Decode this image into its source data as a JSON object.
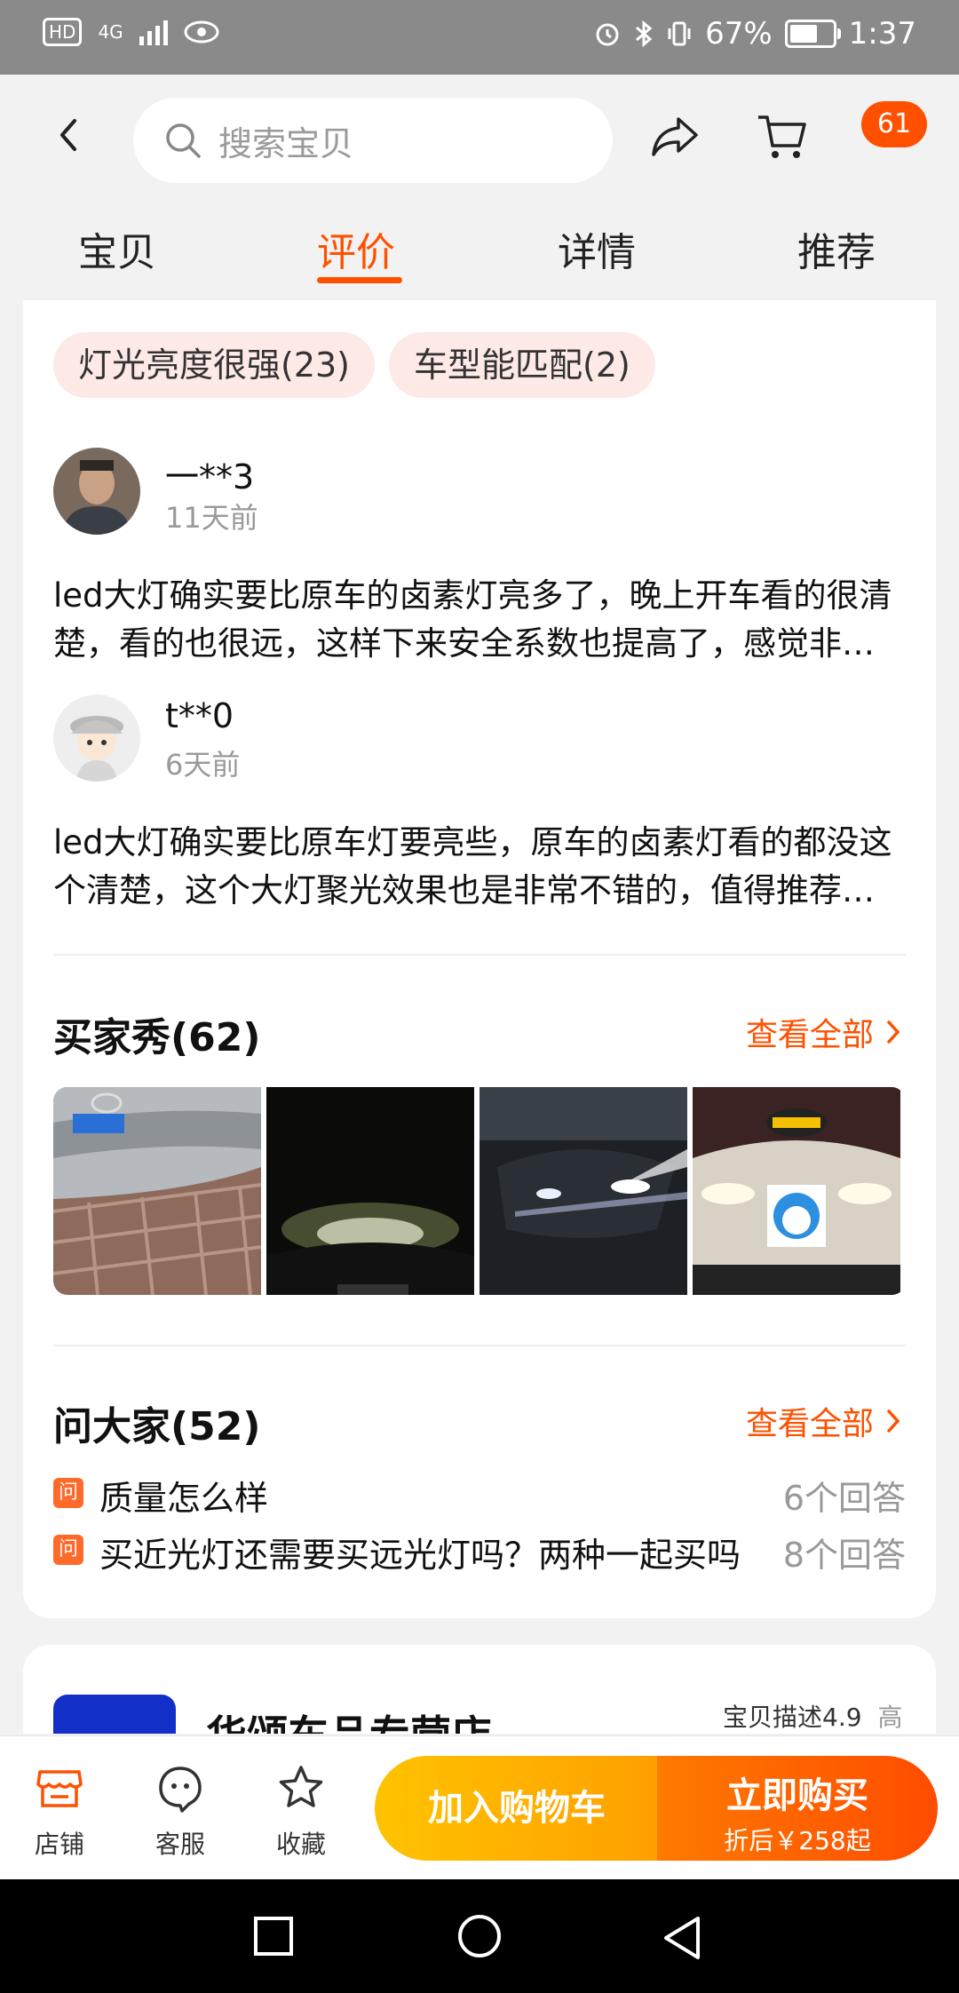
{
  "status": {
    "battery": "67%",
    "time": "1:37",
    "network": "4G",
    "hd": "HD"
  },
  "header": {
    "search_placeholder": "搜索宝贝",
    "cart_badge": "61"
  },
  "tabs": [
    {
      "label": "宝贝"
    },
    {
      "label": "评价",
      "active": true
    },
    {
      "label": "详情"
    },
    {
      "label": "推荐"
    }
  ],
  "review_tags": [
    "灯光亮度很强(23)",
    "车型能匹配(2)"
  ],
  "reviews": [
    {
      "user": "一**3",
      "time": "11天前",
      "text": "led大灯确实要比原车的卤素灯亮多了，晚上开车看的很清楚，看的也很远，这样下来安全系数也提高了，感觉非常不错，值得购买推荐"
    },
    {
      "user": "t**0",
      "time": "6天前",
      "text": "led大灯确实要比原车灯要亮些，原车的卤素灯看的都没这个清楚，这个大灯聚光效果也是非常不错的，值得推荐购买"
    }
  ],
  "buyer_show": {
    "title": "买家秀(62)",
    "link": "查看全部"
  },
  "ask": {
    "title": "问大家(52)",
    "link": "查看全部",
    "icon_char": "问",
    "items": [
      {
        "question": "质量怎么样",
        "answers": "6个回答"
      },
      {
        "question": "买近光灯还需要买远光灯吗？两种一起买吗",
        "answers": "8个回答"
      }
    ]
  },
  "shop": {
    "name": "华颂车品专营店",
    "score": "宝贝描述4.9",
    "level": "高"
  },
  "bottom": {
    "store": "店铺",
    "service": "客服",
    "favorite": "收藏",
    "add_cart": "加入购物车",
    "buy_now": "立即购买",
    "price": "折后￥258起"
  },
  "colors": {
    "accent": "#ff5000",
    "tag_bg": "#fde9e6",
    "cart_yellow": "#ffb400"
  }
}
